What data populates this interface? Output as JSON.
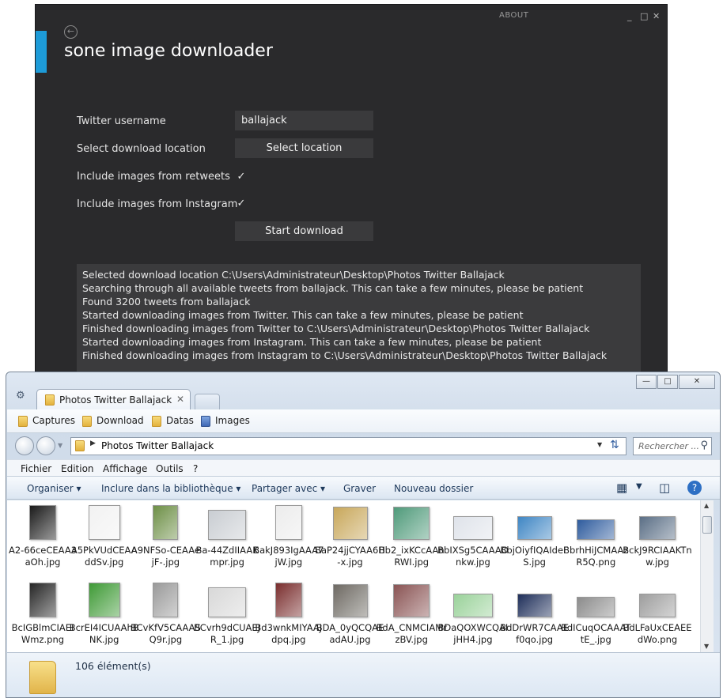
{
  "app": {
    "about": "ABOUT",
    "controls": [
      "_",
      "□",
      "✕"
    ],
    "title": "sone image downloader",
    "username_label": "Twitter username",
    "username_value": "ballajack",
    "location_label": "Select download location",
    "location_button": "Select location",
    "retweets_label": "Include images from retweets",
    "instagram_label": "Include images from Instagram",
    "checkmark": "✓",
    "start_button": "Start download",
    "log": [
      "Selected download location C:\\Users\\Administrateur\\Desktop\\Photos Twitter Ballajack",
      "Searching through all available tweets from ballajack. This can take a few minutes, please be patient",
      "Found 3200 tweets from ballajack",
      "Started downloading images from Twitter. This can take a few minutes, please be patient",
      "Finished downloading images from Twitter to C:\\Users\\Administrateur\\Desktop\\Photos Twitter Ballajack",
      "Started downloading images from Instagram. This can take a few minutes, please be patient",
      "Finished downloading images from Instagram to C:\\Users\\Administrateur\\Desktop\\Photos Twitter Ballajack"
    ]
  },
  "explorer": {
    "tab_title": "Photos Twitter Ballajack",
    "tab_close": "✕",
    "bookmarks": [
      "Captures",
      "Download",
      "Datas",
      "Images"
    ],
    "address": "Photos Twitter Ballajack",
    "search_placeholder": "Rechercher ...",
    "menu": [
      "Fichier",
      "Edition",
      "Affichage",
      "Outils",
      "?"
    ],
    "commands": {
      "organize": "Organiser",
      "library": "Inclure dans la bibliothèque",
      "share": "Partager avec",
      "burn": "Graver",
      "new_folder": "Nouveau dossier"
    },
    "files": [
      {
        "name": "A2-66ceCEAA3aOh.jpg",
        "color": "#1a1a1a"
      },
      {
        "name": "A5PkVUdCEAAddSv.jpg",
        "color": "#f2f2f2"
      },
      {
        "name": "A9NFSo-CEAAejF-.jpg",
        "color": "#6d8f46"
      },
      {
        "name": "Ba-44ZdIIAAKmpr.jpg",
        "color": "#c9cdd2"
      },
      {
        "name": "BakJ893IgAAA7jW.jpg",
        "color": "#ececec"
      },
      {
        "name": "BaP24jjCYAA6H-x.jpg",
        "color": "#c8a75a"
      },
      {
        "name": "Bb2_ixKCcAAnRWI.jpg",
        "color": "#4f9a7a"
      },
      {
        "name": "BbIXSg5CAAAOnkw.jpg",
        "color": "#dfe3ea"
      },
      {
        "name": "BbjOiyfIQAIdeFS.jpg",
        "color": "#3f86c4"
      },
      {
        "name": "BbrhHiJCMAAzR5Q.png",
        "color": "#2f5c9e"
      },
      {
        "name": "BckJ9RCIAAKTnw.jpg",
        "color": "#5b6f86"
      },
      {
        "name": "BcIGBlmCIAEIWmz.png",
        "color": "#262626"
      },
      {
        "name": "BcrEI4ICUAAhBNK.jpg",
        "color": "#3f9a36"
      },
      {
        "name": "BCvKfV5CAAASQ9r.jpg",
        "color": "#9a9a9a"
      },
      {
        "name": "BCvrh9dCUAEJR_1.jpg",
        "color": "#d8d8d8"
      },
      {
        "name": "Bd3wnkMIYAAJdpq.jpg",
        "color": "#7a2e2e"
      },
      {
        "name": "BDA_0yQCQAEadAU.jpg",
        "color": "#6e6a63"
      },
      {
        "name": "BdA_CNMCIAMrzBV.jpg",
        "color": "#8a5454"
      },
      {
        "name": "BDaQOXWCQAIjHH4.jpg",
        "color": "#9ad29a"
      },
      {
        "name": "BdDrWR7CAAEf0qo.jpg",
        "color": "#1f2f5a"
      },
      {
        "name": "BdICuqOCAAATtE_.jpg",
        "color": "#8c8c8c"
      },
      {
        "name": "BdLFaUxCEAEEdWo.png",
        "color": "#9e9e9e"
      }
    ],
    "item_count": "106 élément(s)"
  }
}
